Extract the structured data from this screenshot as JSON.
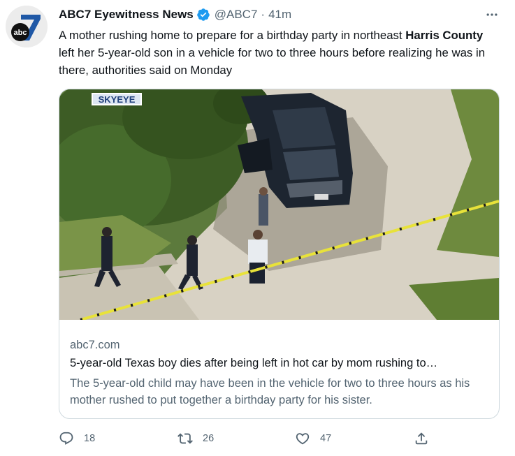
{
  "tweet": {
    "display_name": "ABC7 Eyewitness News",
    "handle": "@ABC7",
    "separator": "·",
    "time": "41m",
    "text_part1": "A mother rushing home to prepare for a birthday party in northeast ",
    "text_bold": "Harris County",
    "text_part2": " left her 5-year-old son in a vehicle for two to three hours before realizing he was in there, authorities said on Monday",
    "avatar_logo": "abc"
  },
  "card": {
    "image_badge": "SKYEYE",
    "domain": "abc7.com",
    "title": "5-year-old Texas boy dies after being left in hot car by mom rushing to…",
    "description": "The 5-year-old child may have been in the vehicle for two to three hours as his mother rushed to put together a birthday party for his sister."
  },
  "actions": {
    "replies": "18",
    "retweets": "26",
    "likes": "47"
  },
  "icons": {
    "verified": "verified-badge-icon",
    "more": "more-dots-icon",
    "reply": "reply-icon",
    "retweet": "retweet-icon",
    "like": "heart-icon",
    "share": "share-icon"
  },
  "colors": {
    "verified_blue": "#1d9bf0",
    "muted_text": "#536471",
    "primary_text": "#0f1419",
    "border": "#cfd9de",
    "abc_badge_blue": "#1f58a6"
  }
}
